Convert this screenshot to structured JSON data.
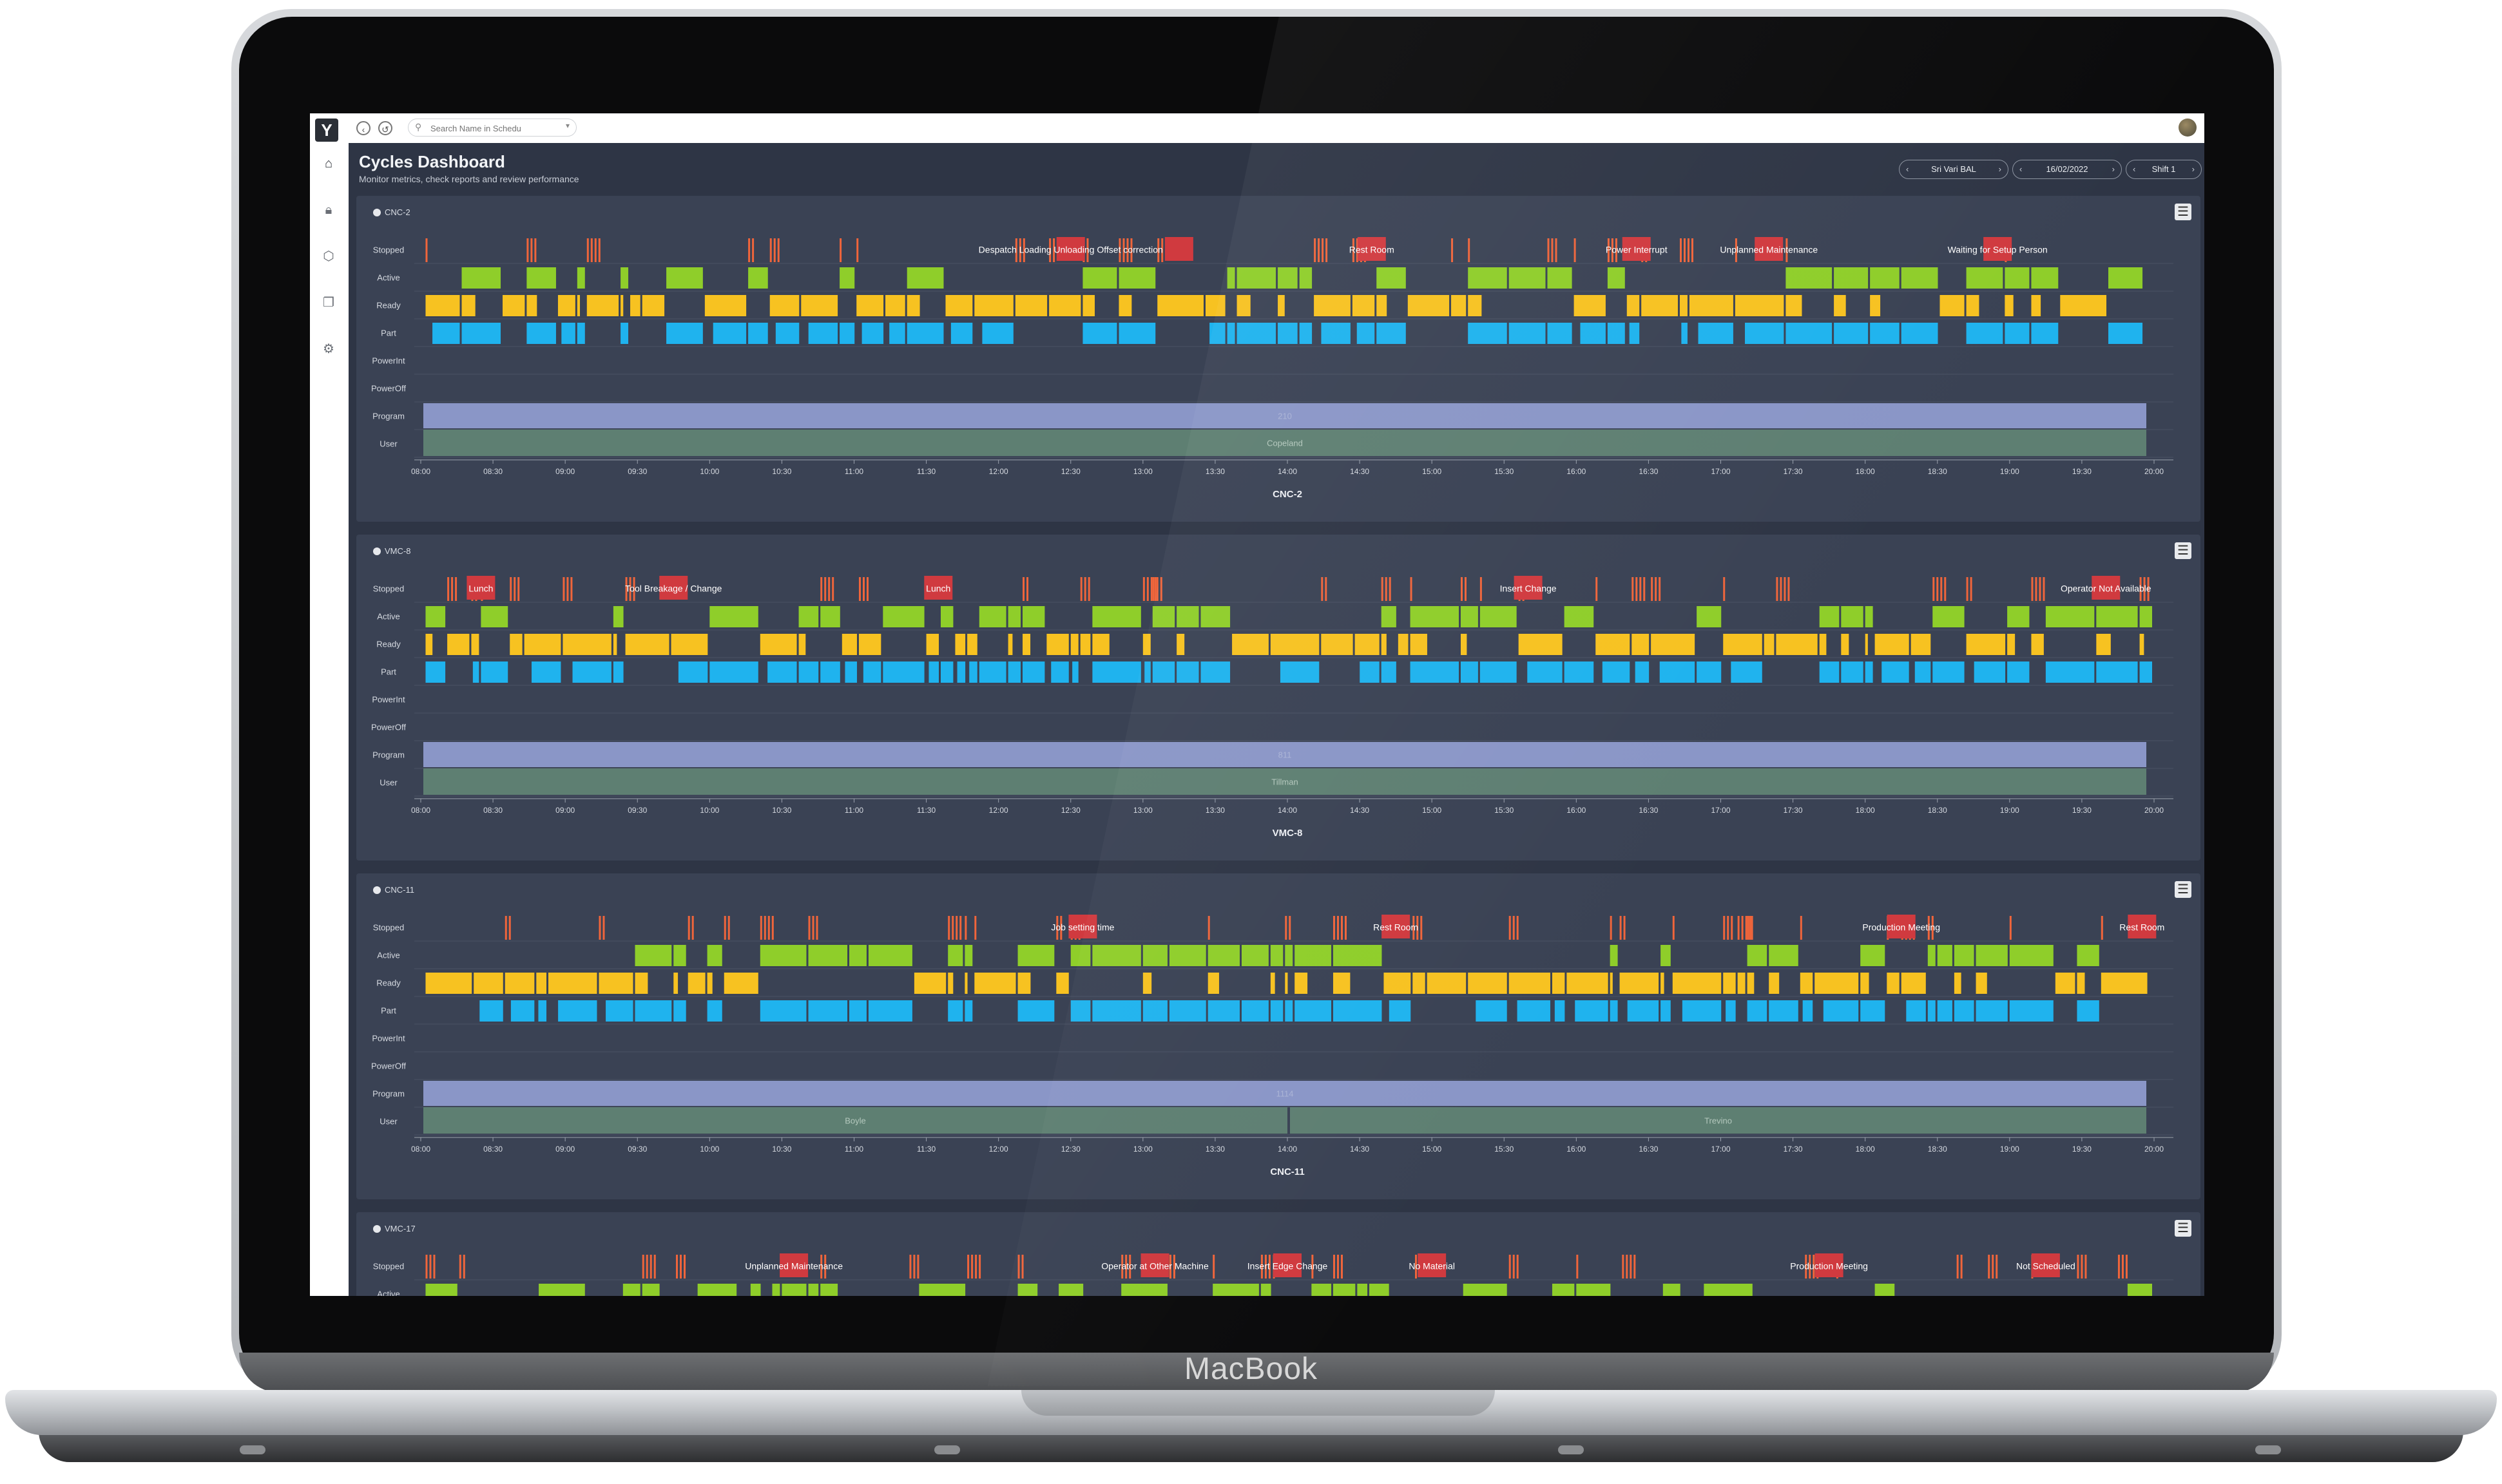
{
  "device": {
    "brand": "MacBook"
  },
  "app": {
    "search": {
      "placeholder": "Search Name in Schedu"
    },
    "page_title": "Cycles Dashboard",
    "page_subtitle": "Monitor metrics, check reports and review performance",
    "filters": {
      "operator": "Sri Vari BAL",
      "date": "16/02/2022",
      "shift": "Shift 1"
    },
    "nav": [
      "home-icon",
      "lock-icon",
      "cube-icon",
      "layers-icon",
      "gear-icon"
    ]
  },
  "lanes": [
    "Stopped",
    "Active",
    "Ready",
    "Part",
    "PowerInt",
    "PowerOff",
    "Program",
    "User"
  ],
  "time_ticks": [
    "08:00",
    "08:30",
    "09:00",
    "09:30",
    "10:00",
    "10:30",
    "11:00",
    "11:30",
    "12:00",
    "12:30",
    "13:00",
    "13:30",
    "14:00",
    "14:30",
    "15:00",
    "15:30",
    "16:00",
    "16:30",
    "17:00",
    "17:30",
    "18:00",
    "18:30",
    "19:00",
    "19:30",
    "20:00"
  ],
  "colors": {
    "stopped_reason": "#d03a3f",
    "stopped_tick": "#f0653b",
    "active": "#8fce2a",
    "ready": "#f7c221",
    "part": "#1fb3ee",
    "program": "#8a96c7",
    "user": "#5e7f72",
    "panel": "#3a4254",
    "page": "#2e3545"
  },
  "machines": [
    {
      "name": "CNC-2",
      "seed": 11,
      "program": "210",
      "users": [
        {
          "name": "Copeland",
          "start": "08:00",
          "end": "20:00"
        }
      ],
      "range": [
        "08:00",
        "20:00"
      ],
      "stops": [
        {
          "label": "Despatch Loading Unloading Offset correction",
          "time": "12:30"
        },
        {
          "label": "",
          "time": "13:15"
        },
        {
          "label": "Rest Room",
          "time": "14:35"
        },
        {
          "label": "Power Interrupt",
          "time": "16:25"
        },
        {
          "label": "Unplanned Maintenance",
          "time": "17:20"
        },
        {
          "label": "Waiting for Setup Person",
          "time": "18:55"
        }
      ]
    },
    {
      "name": "VMC-8",
      "seed": 27,
      "program": "811",
      "users": [
        {
          "name": "Tillman",
          "start": "08:00",
          "end": "20:00"
        }
      ],
      "range": [
        "08:00",
        "20:00"
      ],
      "stops": [
        {
          "label": "Lunch",
          "time": "08:25"
        },
        {
          "label": "Tool Breakage / Change",
          "time": "09:45"
        },
        {
          "label": "Lunch",
          "time": "11:35"
        },
        {
          "label": "Insert Change",
          "time": "15:40"
        },
        {
          "label": "Operator Not Available",
          "time": "19:40"
        }
      ]
    },
    {
      "name": "CNC-11",
      "seed": 43,
      "program": "1114",
      "users": [
        {
          "name": "Boyle",
          "start": "08:00",
          "end": "14:00"
        },
        {
          "name": "Trevino",
          "start": "14:00",
          "end": "20:00"
        }
      ],
      "range": [
        "08:00",
        "20:00"
      ],
      "stops": [
        {
          "label": "Job setting time",
          "time": "12:35"
        },
        {
          "label": "Rest Room",
          "time": "14:45"
        },
        {
          "label": "Production Meeting",
          "time": "18:15"
        },
        {
          "label": "Rest Room",
          "time": "19:55"
        }
      ]
    },
    {
      "name": "VMC-17",
      "seed": 59,
      "program": "",
      "users": [],
      "range": [
        "08:00",
        "20:00"
      ],
      "stops": [
        {
          "label": "Unplanned Maintenance",
          "time": "10:35"
        },
        {
          "label": "Operator at Other Machine",
          "time": "13:05"
        },
        {
          "label": "Insert Edge Change",
          "time": "14:00"
        },
        {
          "label": "No Material",
          "time": "15:00"
        },
        {
          "label": "Production Meeting",
          "time": "17:45"
        },
        {
          "label": "Not Scheduled",
          "time": "19:15"
        }
      ]
    }
  ]
}
